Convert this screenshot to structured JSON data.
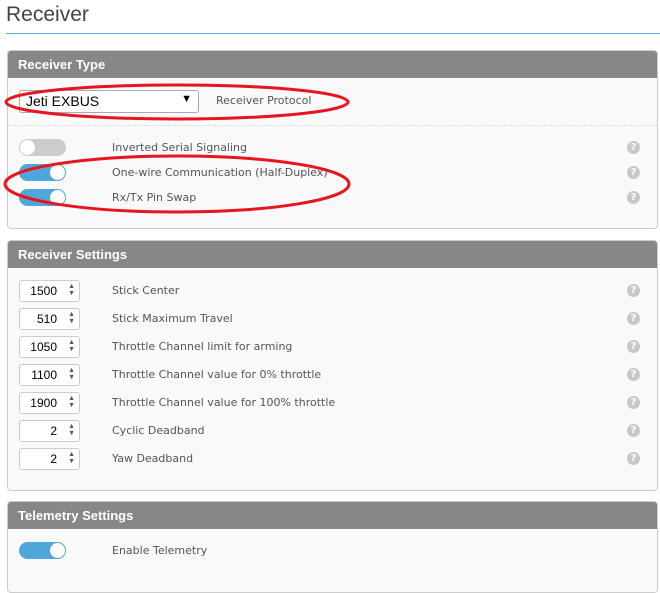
{
  "title": "Receiver",
  "receiver_type": {
    "header": "Receiver Type",
    "protocol_value": "Jeti EXBUS",
    "protocol_label": "Receiver Protocol",
    "toggles": [
      {
        "label": "Inverted Serial Signaling",
        "on": false
      },
      {
        "label": "One-wire Communication (Half-Duplex)",
        "on": true
      },
      {
        "label": "Rx/Tx Pin Swap",
        "on": true
      }
    ]
  },
  "receiver_settings": {
    "header": "Receiver Settings",
    "fields": [
      {
        "value": "1500",
        "label": "Stick Center"
      },
      {
        "value": "510",
        "label": "Stick Maximum Travel"
      },
      {
        "value": "1050",
        "label": "Throttle Channel limit for arming"
      },
      {
        "value": "1100",
        "label": "Throttle Channel value for 0% throttle"
      },
      {
        "value": "1900",
        "label": "Throttle Channel value for 100% throttle"
      },
      {
        "value": "2",
        "label": "Cyclic Deadband"
      },
      {
        "value": "2",
        "label": "Yaw Deadband"
      }
    ]
  },
  "telemetry": {
    "header": "Telemetry Settings",
    "toggle": {
      "label": "Enable Telemetry",
      "on": true
    }
  },
  "help_glyph": "?",
  "colors": {
    "accent": "#4ea6db",
    "header": "#858885",
    "annotation": "#e8141f"
  }
}
